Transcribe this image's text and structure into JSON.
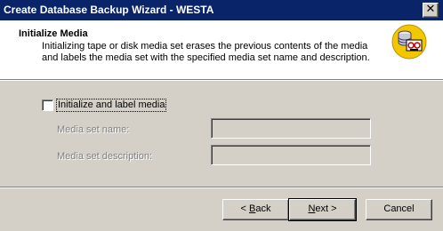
{
  "window": {
    "title": "Create Database Backup Wizard - WESTA",
    "close_glyph": "✕"
  },
  "header": {
    "title": "Initialize Media",
    "description": "Initializing tape or disk media set erases the previous contents of the media and labels the media set with the specified media set name and description.",
    "icon": "database-backup-tape-icon"
  },
  "form": {
    "checkbox_label": "Initialize and label media",
    "checkbox_checked": false,
    "media_set_name_label": "Media set name:",
    "media_set_name_value": "",
    "media_set_description_label": "Media set description:",
    "media_set_description_value": ""
  },
  "buttons": {
    "back_underline": "B",
    "back_rest": "ack",
    "back_prefix": "< ",
    "next_underline": "N",
    "next_rest": "ext",
    "next_suffix": " >",
    "cancel": "Cancel"
  }
}
